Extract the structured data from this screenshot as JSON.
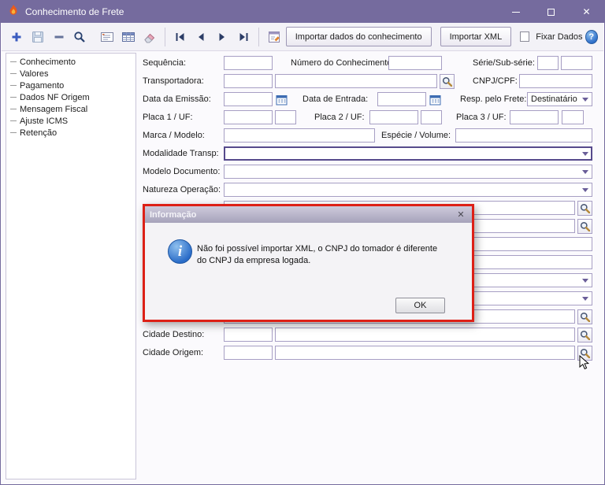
{
  "colors": {
    "titlebar_purple": "#756b9e",
    "dialog_border_red": "#dd2016",
    "info_icon_blue": "#2a6cc8",
    "focused_field_purple": "#564a8c"
  },
  "window": {
    "title": "Conhecimento de Frete",
    "close_glyph": "✕"
  },
  "toolbar": {
    "import_data_button": "Importar dados do conhecimento",
    "import_xml_button": "Importar XML",
    "fixar_dados_label": "Fixar Dados",
    "help_glyph": "?"
  },
  "sidebar": {
    "items": [
      "Conhecimento",
      "Valores",
      "Pagamento",
      "Dados NF Origem",
      "Mensagem Fiscal",
      "Ajuste ICMS",
      "Retenção"
    ]
  },
  "form": {
    "sequencia_label": "Sequência:",
    "numero_conhecimento_label": "Número do Conhecimento:",
    "serie_subserie_label": "Série/Sub-série:",
    "transportadora_label": "Transportadora:",
    "cnpj_cpf_label": "CNPJ/CPF:",
    "data_emissao_label": "Data da Emissão:",
    "data_entrada_label": "Data de Entrada:",
    "resp_frete_label": "Resp. pelo Frete:",
    "resp_frete_value": "Destinatário",
    "placa1_label": "Placa 1 / UF:",
    "placa2_label": "Placa 2 / UF:",
    "placa3_label": "Placa 3 / UF:",
    "marca_modelo_label": "Marca / Modelo:",
    "especie_volume_label": "Espécie / Volume:",
    "modalidade_label": "Modalidade Transp:",
    "modelo_documento_label": "Modelo Documento:",
    "natureza_operacao_label": "Natureza Operação:",
    "cidade_destino_label": "Cidade Destino:",
    "cidade_origem_label": "Cidade Origem:"
  },
  "dialog": {
    "title": "Informação",
    "info_glyph": "i",
    "message_line1": "Não foi possível importar XML, o CNPJ do tomador é diferente",
    "message_line2": "do CNPJ da empresa logada.",
    "ok_button": "OK",
    "close_glyph": "✕"
  }
}
